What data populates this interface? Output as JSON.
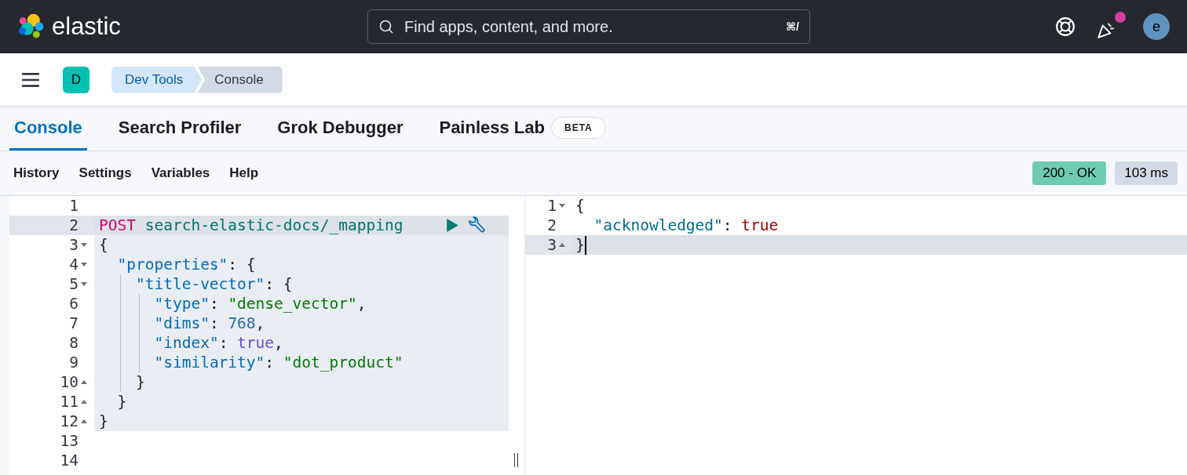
{
  "header": {
    "logo_text": "elastic",
    "search": {
      "placeholder": "Find apps, content, and more.",
      "shortcut": "⌘/"
    },
    "news_unread": true,
    "avatar": "e"
  },
  "breadcrumb_bar": {
    "space": "D",
    "crumbs": [
      {
        "label": "Dev Tools",
        "selected": false
      },
      {
        "label": "Console",
        "selected": true
      }
    ]
  },
  "tabs": [
    {
      "label": "Console",
      "selected": true
    },
    {
      "label": "Search Profiler",
      "selected": false
    },
    {
      "label": "Grok Debugger",
      "selected": false
    },
    {
      "label": "Painless Lab",
      "selected": false,
      "badge": "BETA"
    }
  ],
  "toolbar": {
    "menu": [
      "History",
      "Settings",
      "Variables",
      "Help"
    ],
    "status": "200 - OK",
    "duration": "103 ms"
  },
  "request": {
    "lines": [
      {
        "number": "1",
        "in_request": false,
        "current": false
      },
      {
        "number": "2",
        "in_request": true,
        "current": true,
        "tokens": [
          {
            "kind": "method",
            "text": "POST"
          },
          {
            "kind": "url",
            "text": "search-elastic-docs/_mapping"
          }
        ]
      },
      {
        "number": "3",
        "fold_start": true,
        "in_request": true,
        "current": false,
        "tokens": [
          {
            "kind": "punct",
            "text": "{"
          }
        ],
        "children": [
          {
            "number": "4",
            "fold_start": true,
            "in_request": true,
            "current": false,
            "tokens": [
              {
                "kind": "key",
                "text": "\"properties\""
              },
              {
                "kind": "punct",
                "text": ": {"
              }
            ],
            "children": [
              {
                "number": "5",
                "fold_start": true,
                "in_request": true,
                "current": false,
                "tokens": [
                  {
                    "kind": "key",
                    "text": "\"title-vector\""
                  },
                  {
                    "kind": "punct",
                    "text": ": {"
                  }
                ],
                "children": [
                  {
                    "number": "6",
                    "in_request": true,
                    "current": false,
                    "tokens": [
                      {
                        "kind": "key",
                        "text": "\"type\""
                      },
                      {
                        "kind": "punct",
                        "text": ": "
                      },
                      {
                        "kind": "string",
                        "text": "\"dense_vector\""
                      },
                      {
                        "kind": "punct",
                        "text": ","
                      }
                    ]
                  },
                  {
                    "number": "7",
                    "in_request": true,
                    "current": false,
                    "tokens": [
                      {
                        "kind": "key",
                        "text": "\"dims\""
                      },
                      {
                        "kind": "punct",
                        "text": ": "
                      },
                      {
                        "kind": "number",
                        "text": "768"
                      },
                      {
                        "kind": "punct",
                        "text": ","
                      }
                    ]
                  },
                  {
                    "number": "8",
                    "in_request": true,
                    "current": false,
                    "tokens": [
                      {
                        "kind": "key",
                        "text": "\"index\""
                      },
                      {
                        "kind": "punct",
                        "text": ": "
                      },
                      {
                        "kind": "bool",
                        "text": "true"
                      },
                      {
                        "kind": "punct",
                        "text": ","
                      }
                    ]
                  },
                  {
                    "number": "9",
                    "in_request": true,
                    "current": false,
                    "tokens": [
                      {
                        "kind": "key",
                        "text": "\"similarity\""
                      },
                      {
                        "kind": "punct",
                        "text": ": "
                      },
                      {
                        "kind": "string",
                        "text": "\"dot_product\""
                      }
                    ]
                  }
                ]
              },
              {
                "number": "10",
                "fold_end": true,
                "in_request": true,
                "current": false,
                "tokens": [
                  {
                    "kind": "punct",
                    "text": "}"
                  }
                ]
              }
            ]
          },
          {
            "number": "11",
            "fold_end": true,
            "in_request": true,
            "current": false,
            "tokens": [
              {
                "kind": "punct",
                "text": "}"
              }
            ]
          }
        ]
      },
      {
        "number": "12",
        "fold_end": true,
        "in_request": true,
        "current": false,
        "tokens": [
          {
            "kind": "punct",
            "text": "}"
          }
        ]
      },
      {
        "number": "13",
        "in_request": false,
        "current": false
      },
      {
        "number": "14",
        "in_request": false,
        "current": false
      }
    ]
  },
  "response": {
    "lines": [
      {
        "number": "1",
        "fold_start": true,
        "current": false,
        "tokens": [
          {
            "kind": "punct",
            "text": "{"
          }
        ],
        "children": [
          {
            "number": "2",
            "current": false,
            "tokens": [
              {
                "kind": "rkey",
                "text": "\"acknowledged\""
              },
              {
                "kind": "punct",
                "text": ": "
              },
              {
                "kind": "rbool",
                "text": "true"
              }
            ]
          }
        ]
      },
      {
        "number": "3",
        "fold_end": true,
        "current": true,
        "tokens": [
          {
            "kind": "punct",
            "text": "}"
          }
        ]
      }
    ]
  }
}
